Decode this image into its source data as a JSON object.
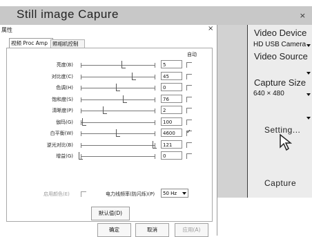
{
  "app": {
    "title": "Still image Capure",
    "close": "×"
  },
  "right_panel": {
    "video_device_label": "Video Device",
    "video_device_value": "HD USB Camera",
    "video_source_label": "Video Source",
    "video_source_value": "",
    "capture_size_label": "Capture Size",
    "capture_size_value": "640 × 480",
    "extra_select_value": "",
    "setting_label": "Setting...",
    "capture_label": "Capture"
  },
  "dialog": {
    "title": "属性",
    "close": "×",
    "tabs": [
      {
        "label": "视频 Proc Amp"
      },
      {
        "label": "照相机控制"
      }
    ],
    "auto_header": "自动",
    "rows": [
      {
        "label": "亮度(B)",
        "value": "5",
        "level": 0.58,
        "auto": false
      },
      {
        "label": "对比度(C)",
        "value": "45",
        "level": 0.72,
        "auto": false
      },
      {
        "label": "色调(H)",
        "value": "0",
        "level": 0.5,
        "auto": false
      },
      {
        "label": "饱和度(S)",
        "value": "76",
        "level": 0.6,
        "auto": false
      },
      {
        "label": "清晰度(P)",
        "value": "2",
        "level": 0.33,
        "auto": false
      },
      {
        "label": "伽玛(G)",
        "value": "100",
        "level": 0.05,
        "auto": false
      },
      {
        "label": "白平衡(W)",
        "value": "4600",
        "level": 0.5,
        "auto": true
      },
      {
        "label": "逆光对比(B)",
        "value": "121",
        "level": 1.0,
        "auto": false
      },
      {
        "label": "增益(G)",
        "value": "0",
        "level": 0.0,
        "auto": false
      }
    ],
    "color_enable_label": "启用颜色(E)",
    "power_freq_label": "电力线频率(防闪烁)(P)",
    "power_freq_value": "50 Hz",
    "default_button": "默认值(D)",
    "ok_button": "确定",
    "cancel_button": "取消",
    "apply_button": "应用(A)"
  },
  "colors": {
    "titlebar": "#c8c8c8",
    "right_panel_bg": "#ececec",
    "dialog_bg": "#ffffff"
  }
}
